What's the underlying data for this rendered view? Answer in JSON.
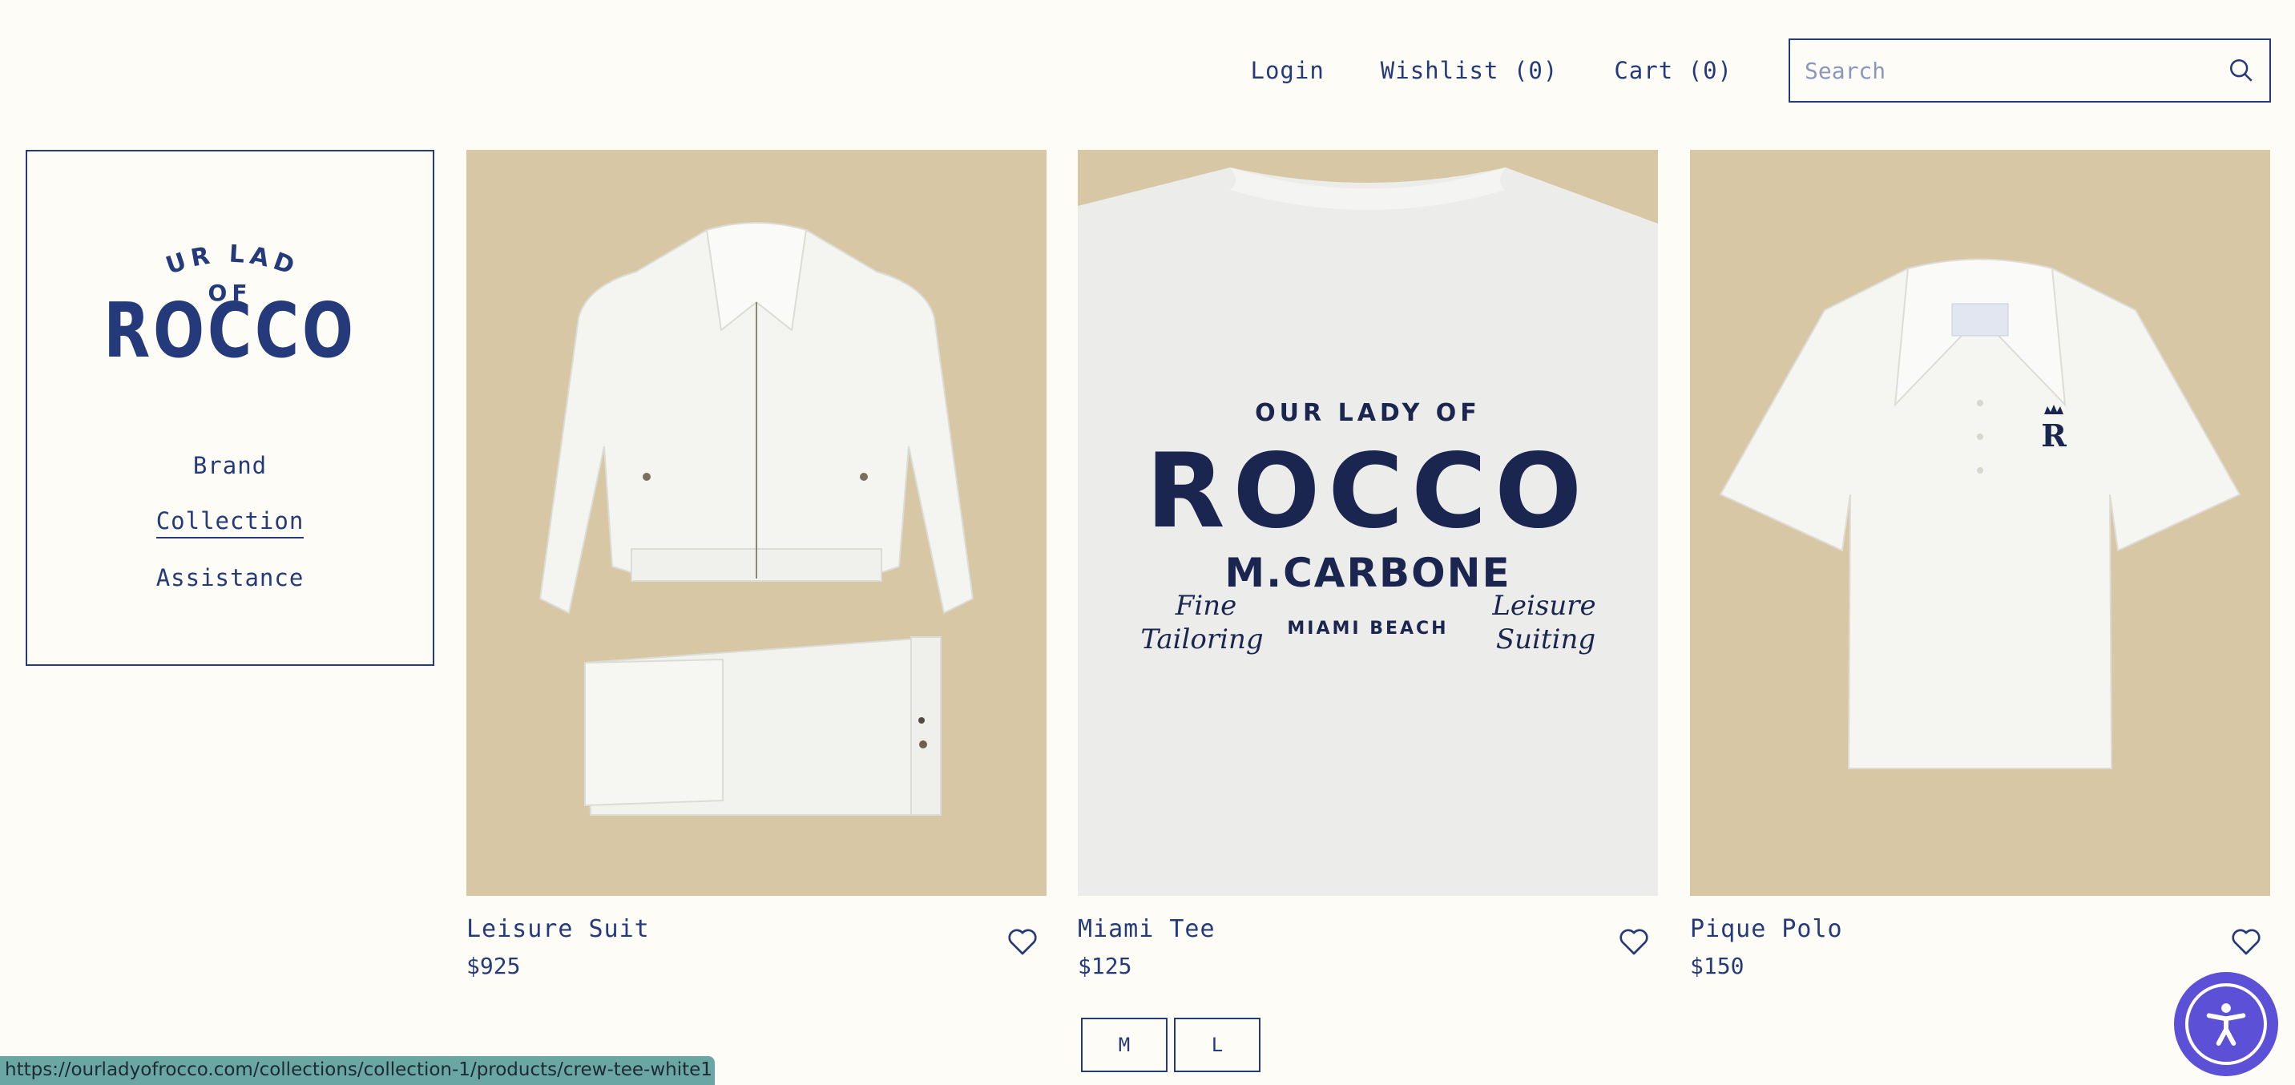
{
  "nav": {
    "login": "Login",
    "wishlist": "Wishlist (0)",
    "cart": "Cart (0)"
  },
  "search": {
    "placeholder": "Search",
    "icon": "search-icon"
  },
  "logo": {
    "line1": "OUR LADY",
    "line2": "OF",
    "line3": "ROCCO"
  },
  "sidebar": {
    "items": [
      {
        "label": "Brand",
        "active": false
      },
      {
        "label": "Collection",
        "active": true
      },
      {
        "label": "Assistance",
        "active": false
      }
    ]
  },
  "products": [
    {
      "name": "Leisure Suit",
      "price": "$925",
      "icon": "heart-icon"
    },
    {
      "name": "Miami Tee",
      "price": "$125",
      "icon": "heart-icon",
      "print": {
        "line1": "OUR LADY OF",
        "line2": "ROCCO",
        "line3": "M.CARBONE",
        "left1": "Fine",
        "left2": "Tailoring",
        "center": "MIAMI BEACH",
        "right1": "Leisure",
        "right2": "Suiting"
      }
    },
    {
      "name": "Pique Polo",
      "price": "$150",
      "icon": "heart-icon"
    }
  ],
  "sizes": [
    "M",
    "L"
  ],
  "status_url": "https://ourladyofrocco.com/collections/collection-1/products/crew-tee-white1",
  "colors": {
    "navy": "#243a7a",
    "background": "#fdfcf7",
    "tan": "#d9c8a6",
    "accessibility": "#5b50d6",
    "status": "#6aa7a4"
  }
}
